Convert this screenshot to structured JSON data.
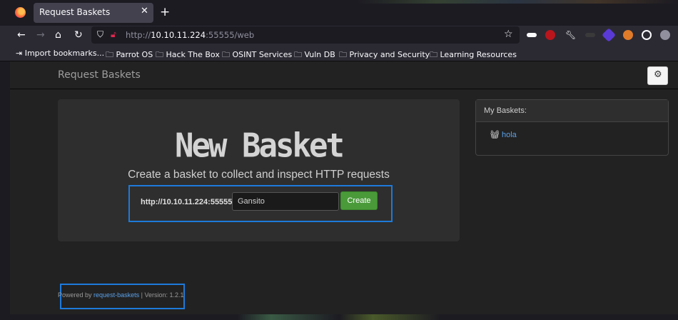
{
  "browser": {
    "tab_title": "Request Baskets",
    "url_prefix": "http://",
    "url_host": "10.10.11.224",
    "url_rest": ":55555/web",
    "bookmarks": [
      "Import bookmarks...",
      "Parrot OS",
      "Hack The Box",
      "OSINT Services",
      "Vuln DB",
      "Privacy and Security",
      "Learning Resources"
    ]
  },
  "app": {
    "brand": "Request Baskets",
    "jumbotron": {
      "title": "New Basket",
      "subtitle": "Create a basket to collect and inspect HTTP requests",
      "url_prefix": "http://10.10.11.224:55555/",
      "basket_name_value": "Gansito",
      "create_label": "Create"
    },
    "my_baskets": {
      "title": "My Baskets:",
      "items": [
        "hola"
      ]
    },
    "footer": {
      "powered_by": "Powered by",
      "link_text": "request-baskets",
      "version": "| Version: 1.2.1"
    }
  },
  "colors": {
    "accent_link": "#5aa0e8",
    "create_button": "#4a9a3a",
    "highlight_box": "#1d7adb"
  }
}
